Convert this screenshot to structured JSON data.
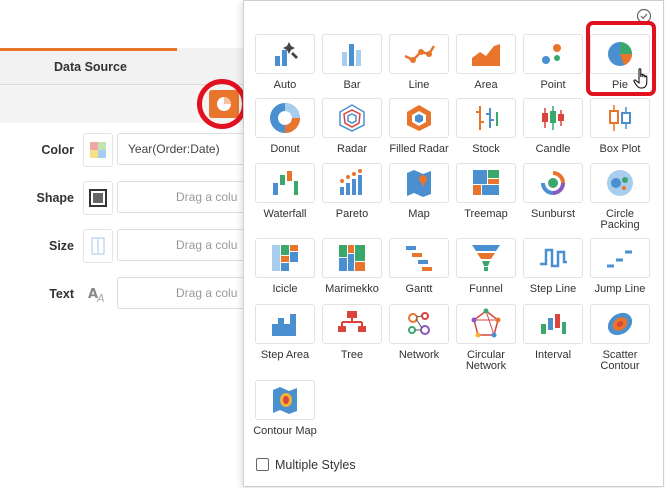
{
  "data_source_tab": {
    "label": "Data Source"
  },
  "shelves": [
    {
      "label": "Color",
      "value": "Year(Order:Date)",
      "placeholder": ""
    },
    {
      "label": "Shape",
      "value": "",
      "placeholder": "Drag a colu"
    },
    {
      "label": "Size",
      "value": "",
      "placeholder": "Drag a colu"
    },
    {
      "label": "Text",
      "value": "",
      "placeholder": "Drag a colu"
    }
  ],
  "chart_types": [
    {
      "label": "Auto",
      "icon": "auto-chart-icon"
    },
    {
      "label": "Bar",
      "icon": "bar-chart-icon"
    },
    {
      "label": "Line",
      "icon": "line-chart-icon"
    },
    {
      "label": "Area",
      "icon": "area-chart-icon"
    },
    {
      "label": "Point",
      "icon": "point-chart-icon"
    },
    {
      "label": "Pie",
      "icon": "pie-chart-icon"
    },
    {
      "label": "Donut",
      "icon": "donut-chart-icon"
    },
    {
      "label": "Radar",
      "icon": "radar-chart-icon"
    },
    {
      "label": "Filled Radar",
      "icon": "filled-radar-chart-icon"
    },
    {
      "label": "Stock",
      "icon": "stock-chart-icon"
    },
    {
      "label": "Candle",
      "icon": "candle-chart-icon"
    },
    {
      "label": "Box Plot",
      "icon": "box-plot-icon"
    },
    {
      "label": "Waterfall",
      "icon": "waterfall-chart-icon"
    },
    {
      "label": "Pareto",
      "icon": "pareto-chart-icon"
    },
    {
      "label": "Map",
      "icon": "map-chart-icon"
    },
    {
      "label": "Treemap",
      "icon": "treemap-chart-icon"
    },
    {
      "label": "Sunburst",
      "icon": "sunburst-chart-icon"
    },
    {
      "label": "Circle Packing",
      "icon": "circle-packing-icon"
    },
    {
      "label": "Icicle",
      "icon": "icicle-chart-icon"
    },
    {
      "label": "Marimekko",
      "icon": "marimekko-chart-icon"
    },
    {
      "label": "Gantt",
      "icon": "gantt-chart-icon"
    },
    {
      "label": "Funnel",
      "icon": "funnel-chart-icon"
    },
    {
      "label": "Step Line",
      "icon": "step-line-chart-icon"
    },
    {
      "label": "Jump Line",
      "icon": "jump-line-chart-icon"
    },
    {
      "label": "Step Area",
      "icon": "step-area-chart-icon"
    },
    {
      "label": "Tree",
      "icon": "tree-chart-icon"
    },
    {
      "label": "Network",
      "icon": "network-chart-icon"
    },
    {
      "label": "Circular Network",
      "icon": "circular-network-icon"
    },
    {
      "label": "Interval",
      "icon": "interval-chart-icon"
    },
    {
      "label": "Scatter Contour",
      "icon": "scatter-contour-icon"
    },
    {
      "label": "Contour Map",
      "icon": "contour-map-icon"
    }
  ],
  "selected_chart": "Pie",
  "multiple_styles": {
    "label": "Multiple Styles",
    "checked": false
  },
  "colors": {
    "accent": "#e8752b",
    "chart_blue": "#4a90d0",
    "highlight_red": "#e0121f"
  }
}
